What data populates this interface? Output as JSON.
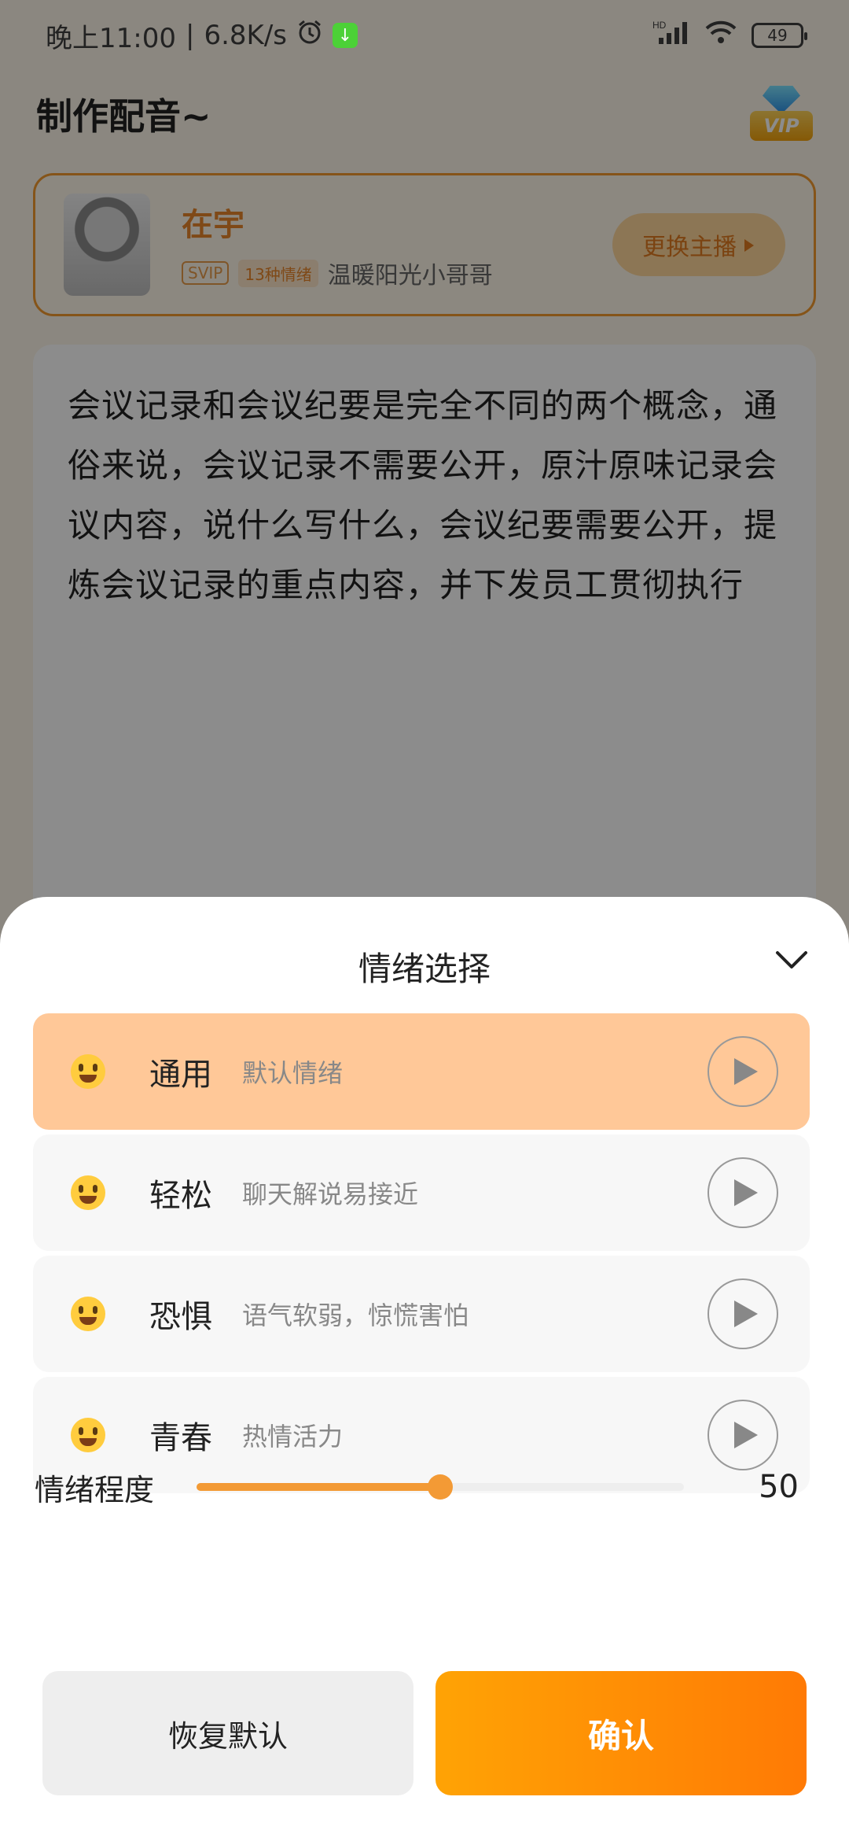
{
  "status_bar": {
    "time": "晚上11:00",
    "network_speed": "6.8K/s",
    "battery": "49"
  },
  "header": {
    "title": "制作配音~",
    "vip_label": "VIP"
  },
  "voice_card": {
    "name": "在宇",
    "svip_tag": "SVIP",
    "emotion_tag": "13种情绪",
    "description": "温暖阳光小哥哥",
    "switch_label": "更换主播"
  },
  "script": {
    "text": "会议记录和会议纪要是完全不同的两个概念，通俗来说，会议记录不需要公开，原汁原味记录会议内容，说什么写什么，会议纪要需要公开，提炼会议记录的重点内容，并下发员工贯彻执行"
  },
  "sheet": {
    "title": "情绪选择",
    "emotions": [
      {
        "name": "通用",
        "desc": "默认情绪",
        "selected": true
      },
      {
        "name": "轻松",
        "desc": "聊天解说易接近",
        "selected": false
      },
      {
        "name": "恐惧",
        "desc": "语气软弱，惊慌害怕",
        "selected": false
      },
      {
        "name": "青春",
        "desc": "热情活力",
        "selected": false
      }
    ],
    "intensity_label": "情绪程度",
    "intensity_value": "50",
    "intensity_fraction": 0.5,
    "reset_label": "恢复默认",
    "confirm_label": "确认"
  },
  "colors": {
    "accent": "#f39a35",
    "selected_row": "#ffc898",
    "confirm_gradient_start": "#ffa305",
    "confirm_gradient_end": "#ff7a05"
  }
}
